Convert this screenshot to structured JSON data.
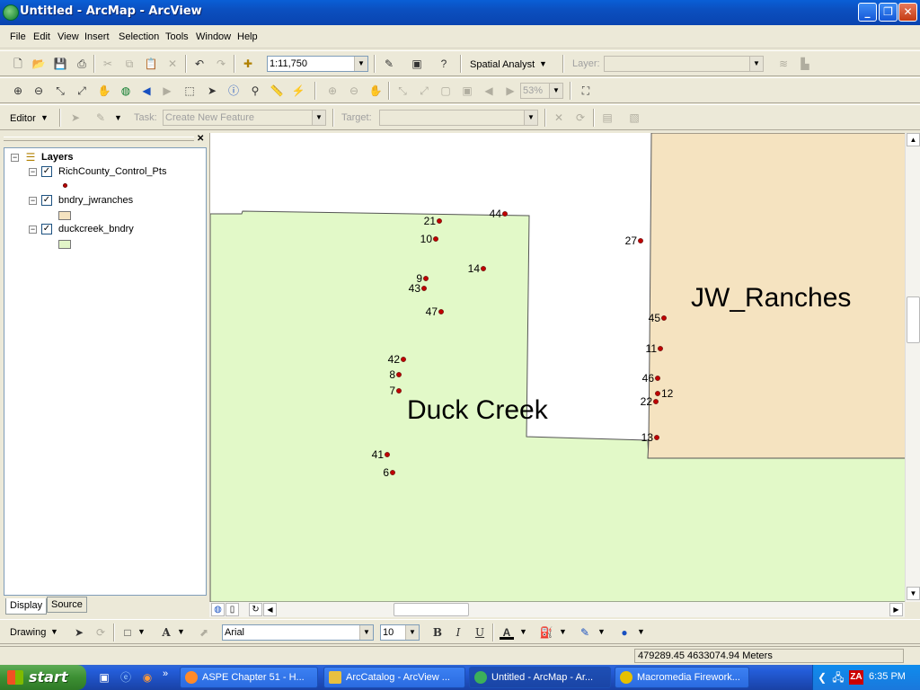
{
  "window": {
    "title": "Untitled - ArcMap - ArcView"
  },
  "menu": [
    "File",
    "Edit",
    "View",
    "Insert",
    "Selection",
    "Tools",
    "Window",
    "Help"
  ],
  "standard_toolbar": {
    "scale_value": "1:11,750",
    "spatial_analyst_label": "Spatial Analyst",
    "layer_label": "Layer:",
    "layer_value": ""
  },
  "tools_toolbar": {
    "zoom_value": "53%"
  },
  "editor_toolbar": {
    "editor_label": "Editor",
    "task_label": "Task:",
    "task_value": "Create New Feature",
    "target_label": "Target:",
    "target_value": ""
  },
  "toc": {
    "root_label": "Layers",
    "layers": [
      {
        "name": "RichCounty_Control_Pts",
        "checked": true,
        "symbol": "point",
        "color": "#c00000"
      },
      {
        "name": "bndry_jwranches",
        "checked": true,
        "symbol": "polygon",
        "color": "#f5e3c0"
      },
      {
        "name": "duckcreek_bndry",
        "checked": true,
        "symbol": "polygon",
        "color": "#e2f5c8"
      }
    ],
    "tabs": [
      "Display",
      "Source"
    ]
  },
  "map": {
    "colors": {
      "duck_creek": "#e2f9c8",
      "jw_ranches": "#f5e3c0",
      "point": "#c00000"
    },
    "area_labels": [
      "Duck Creek",
      "JW_Ranches"
    ],
    "points": [
      {
        "id": "44"
      },
      {
        "id": "21"
      },
      {
        "id": "10"
      },
      {
        "id": "27"
      },
      {
        "id": "14"
      },
      {
        "id": "9"
      },
      {
        "id": "43"
      },
      {
        "id": "47"
      },
      {
        "id": "45"
      },
      {
        "id": "11"
      },
      {
        "id": "42"
      },
      {
        "id": "8"
      },
      {
        "id": "46"
      },
      {
        "id": "7"
      },
      {
        "id": "22"
      },
      {
        "id": "12"
      },
      {
        "id": "13"
      },
      {
        "id": "41"
      },
      {
        "id": "6"
      }
    ]
  },
  "drawing_toolbar": {
    "drawing_label": "Drawing",
    "font_name": "Arial",
    "font_size": "10"
  },
  "status": {
    "coordinates": "479289.45  4633074.94 Meters"
  },
  "taskbar": {
    "start_label": "start",
    "tasks": [
      "ASPE Chapter 51 - H...",
      "ArcCatalog - ArcView ...",
      "Untitled - ArcMap - Ar...",
      "Macromedia Firework..."
    ],
    "clock": "6:35 PM"
  }
}
